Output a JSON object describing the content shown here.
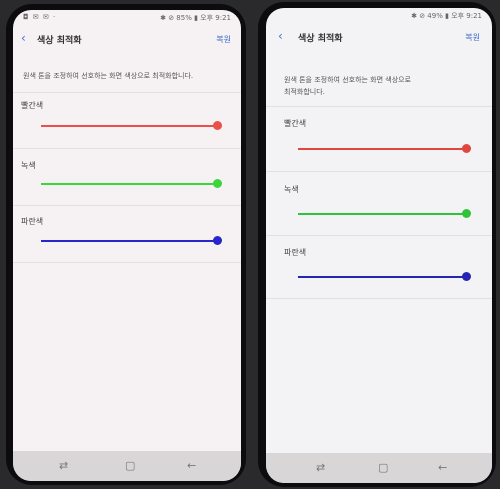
{
  "left": {
    "status_left": "◘ ✉ ✉ ·",
    "status_right": "✱ ⊘ 85% ▮ 오후 9:21",
    "title": "색상 최적화",
    "reset": "복원",
    "desc": "원색 톤을 조정하여 선호하는 화면 색상으로 최적화합니다.",
    "sliders": [
      {
        "label": "빨간색",
        "color": "#e8504a",
        "level": 1.0
      },
      {
        "label": "녹색",
        "color": "#3ad63a",
        "level": 1.0
      },
      {
        "label": "파란색",
        "color": "#2626c9",
        "level": 1.0
      }
    ]
  },
  "right": {
    "status_right": "✱ ⊘ 49% ▮ 오후 9:21",
    "title": "색상 최적화",
    "reset": "복원",
    "desc_line1": "원색 톤을 조정하여 선호하는 화면 색상으로",
    "desc_line2": "최적화합니다.",
    "sliders": [
      {
        "label": "빨간색",
        "color": "#e0463d",
        "level": 1.0
      },
      {
        "label": "녹색",
        "color": "#2ec43a",
        "level": 1.0
      },
      {
        "label": "파란색",
        "color": "#2525b5",
        "level": 1.0
      }
    ]
  },
  "nav": {
    "recent_icon": "⇄",
    "home_icon": "▢",
    "back_icon": "←"
  }
}
